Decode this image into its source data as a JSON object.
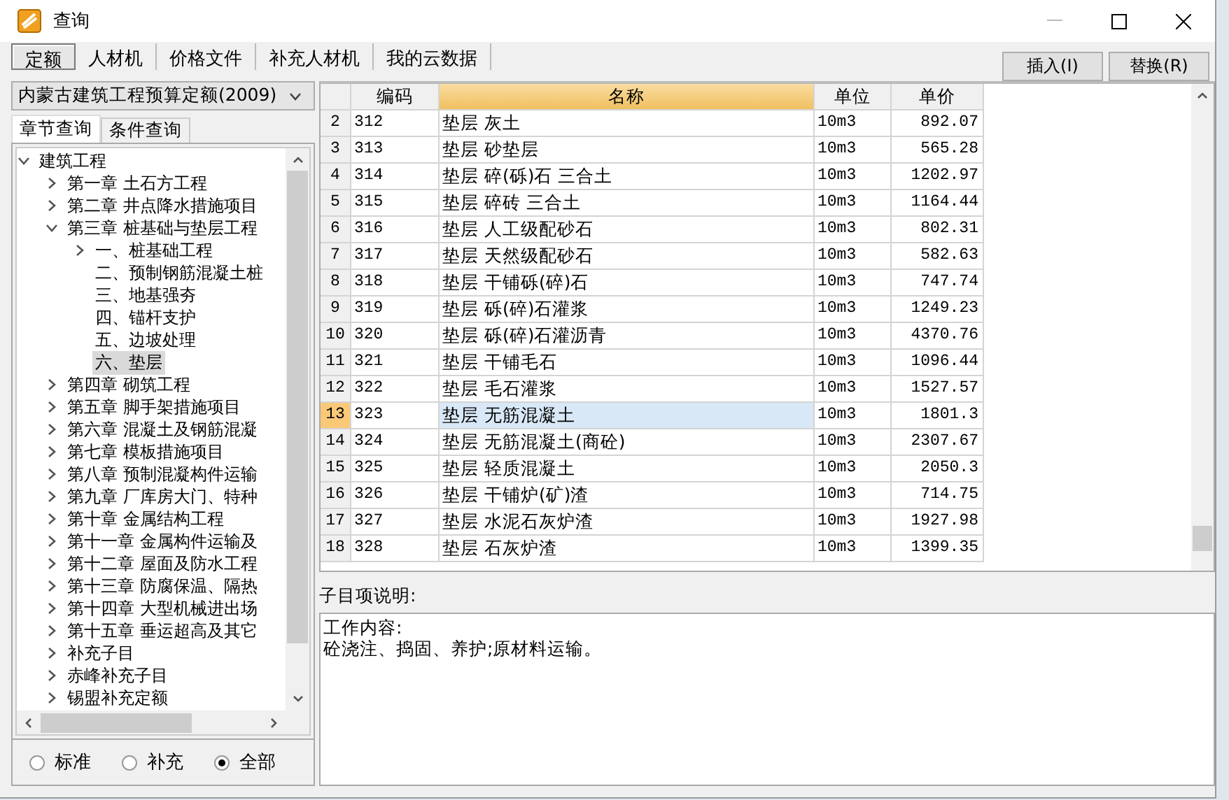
{
  "window": {
    "title": "查询"
  },
  "tabs": [
    {
      "label": "定额",
      "selected": true
    },
    {
      "label": "人材机",
      "selected": false
    },
    {
      "label": "价格文件",
      "selected": false
    },
    {
      "label": "补充人材机",
      "selected": false
    },
    {
      "label": "我的云数据",
      "selected": false
    }
  ],
  "actions": [
    "插入(I)",
    "替换(R)"
  ],
  "quota_dropdown": {
    "value": "内蒙古建筑工程预算定额(2009)"
  },
  "sub_tabs": [
    {
      "label": "章节查询",
      "selected": true
    },
    {
      "label": "条件查询",
      "selected": false
    }
  ],
  "tree": {
    "items": [
      {
        "label": "建筑工程",
        "kind": "branch",
        "expanded": true,
        "selected": false,
        "children": [
          {
            "label": "第一章  土石方工程",
            "kind": "branch",
            "expanded": false,
            "selected": false
          },
          {
            "label": "第二章  井点降水措施项目",
            "kind": "branch",
            "expanded": false,
            "selected": false
          },
          {
            "label": "第三章  桩基础与垫层工程",
            "kind": "branch",
            "expanded": true,
            "selected": false,
            "children": [
              {
                "label": "一、桩基础工程",
                "kind": "branch",
                "expanded": false,
                "selected": false
              },
              {
                "label": "二、预制钢筋混凝土桩",
                "kind": "leaf",
                "selected": false
              },
              {
                "label": "三、地基强夯",
                "kind": "leaf",
                "selected": false
              },
              {
                "label": "四、锚杆支护",
                "kind": "leaf",
                "selected": false
              },
              {
                "label": "五、边坡处理",
                "kind": "leaf",
                "selected": false
              },
              {
                "label": "六、垫层",
                "kind": "leaf",
                "selected": true
              }
            ]
          },
          {
            "label": "第四章  砌筑工程",
            "kind": "branch",
            "expanded": false,
            "selected": false
          },
          {
            "label": "第五章  脚手架措施项目",
            "kind": "branch",
            "expanded": false,
            "selected": false
          },
          {
            "label": "第六章  混凝土及钢筋混凝",
            "kind": "branch",
            "expanded": false,
            "selected": false
          },
          {
            "label": "第七章  模板措施项目",
            "kind": "branch",
            "expanded": false,
            "selected": false
          },
          {
            "label": "第八章  预制混凝构件运输",
            "kind": "branch",
            "expanded": false,
            "selected": false
          },
          {
            "label": "第九章  厂库房大门、特种",
            "kind": "branch",
            "expanded": false,
            "selected": false
          },
          {
            "label": "第十章  金属结构工程",
            "kind": "branch",
            "expanded": false,
            "selected": false
          },
          {
            "label": "第十一章  金属构件运输及",
            "kind": "branch",
            "expanded": false,
            "selected": false
          },
          {
            "label": "第十二章  屋面及防水工程",
            "kind": "branch",
            "expanded": false,
            "selected": false
          },
          {
            "label": "第十三章  防腐保温、隔热",
            "kind": "branch",
            "expanded": false,
            "selected": false
          },
          {
            "label": "第十四章  大型机械进出场",
            "kind": "branch",
            "expanded": false,
            "selected": false
          },
          {
            "label": "第十五章  垂运超高及其它",
            "kind": "branch",
            "expanded": false,
            "selected": false
          },
          {
            "label": "补充子目",
            "kind": "branch",
            "expanded": false,
            "selected": false
          },
          {
            "label": "赤峰补充子目",
            "kind": "branch",
            "expanded": false,
            "selected": false
          },
          {
            "label": "锡盟补充定额",
            "kind": "branch",
            "expanded": false,
            "selected": false
          }
        ]
      }
    ]
  },
  "scope_options": [
    {
      "label": "标准",
      "selected": false
    },
    {
      "label": "补充",
      "selected": false
    },
    {
      "label": "全部",
      "selected": true
    }
  ],
  "table": {
    "columns": [
      "编码",
      "名称",
      "单位",
      "单价"
    ],
    "rows": [
      {
        "index": "2",
        "code": "312",
        "name": "垫层 灰土",
        "unit": "10m3",
        "price": "892.07",
        "selected": false
      },
      {
        "index": "3",
        "code": "313",
        "name": "垫层 砂垫层",
        "unit": "10m3",
        "price": "565.28",
        "selected": false
      },
      {
        "index": "4",
        "code": "314",
        "name": "垫层 碎(砾)石 三合土",
        "unit": "10m3",
        "price": "1202.97",
        "selected": false
      },
      {
        "index": "5",
        "code": "315",
        "name": "垫层 碎砖 三合土",
        "unit": "10m3",
        "price": "1164.44",
        "selected": false
      },
      {
        "index": "6",
        "code": "316",
        "name": "垫层 人工级配砂石",
        "unit": "10m3",
        "price": "802.31",
        "selected": false
      },
      {
        "index": "7",
        "code": "317",
        "name": "垫层 天然级配砂石",
        "unit": "10m3",
        "price": "582.63",
        "selected": false
      },
      {
        "index": "8",
        "code": "318",
        "name": "垫层 干铺砾(碎)石",
        "unit": "10m3",
        "price": "747.74",
        "selected": false
      },
      {
        "index": "9",
        "code": "319",
        "name": "垫层 砾(碎)石灌浆",
        "unit": "10m3",
        "price": "1249.23",
        "selected": false
      },
      {
        "index": "10",
        "code": "320",
        "name": "垫层 砾(碎)石灌沥青",
        "unit": "10m3",
        "price": "4370.76",
        "selected": false
      },
      {
        "index": "11",
        "code": "321",
        "name": "垫层 干铺毛石",
        "unit": "10m3",
        "price": "1096.44",
        "selected": false
      },
      {
        "index": "12",
        "code": "322",
        "name": "垫层 毛石灌浆",
        "unit": "10m3",
        "price": "1527.57",
        "selected": false
      },
      {
        "index": "13",
        "code": "323",
        "name": "垫层 无筋混凝土",
        "unit": "10m3",
        "price": "1801.3",
        "selected": true
      },
      {
        "index": "14",
        "code": "324",
        "name": "垫层 无筋混凝土(商砼)",
        "unit": "10m3",
        "price": "2307.67",
        "selected": false
      },
      {
        "index": "15",
        "code": "325",
        "name": "垫层 轻质混凝土",
        "unit": "10m3",
        "price": "2050.3",
        "selected": false
      },
      {
        "index": "16",
        "code": "326",
        "name": "垫层 干铺炉(矿)渣",
        "unit": "10m3",
        "price": "714.75",
        "selected": false
      },
      {
        "index": "17",
        "code": "327",
        "name": "垫层 水泥石灰炉渣",
        "unit": "10m3",
        "price": "1927.98",
        "selected": false
      },
      {
        "index": "18",
        "code": "328",
        "name": "垫层 石灰炉渣",
        "unit": "10m3",
        "price": "1399.35",
        "selected": false
      }
    ]
  },
  "description": {
    "label": "子目项说明:",
    "lines": [
      "工作内容:",
      "砼浇注、捣固、养护;原材料运输。"
    ]
  }
}
